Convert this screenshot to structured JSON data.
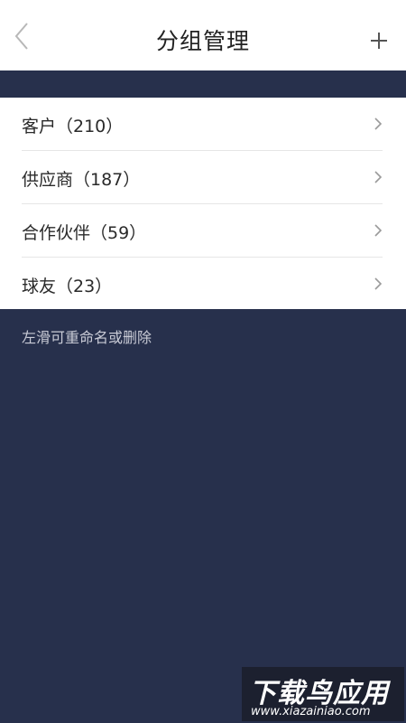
{
  "header": {
    "title": "分组管理",
    "back_icon": "chevron-left-icon",
    "add_icon": "plus-icon"
  },
  "groups": [
    {
      "label": "客户（210）"
    },
    {
      "label": "供应商（187）"
    },
    {
      "label": "合作伙伴（59）"
    },
    {
      "label": "球友（23）"
    }
  ],
  "hint": "左滑可重命名或删除",
  "watermark": {
    "main": "下载鸟应用",
    "sub": "www.xiazainiao.com"
  },
  "colors": {
    "background": "#27304c",
    "surface": "#ffffff",
    "text": "#2a2a2a",
    "hint": "#c9cbd6",
    "divider": "#e6e6e6",
    "icon": "#9a9a9a"
  }
}
